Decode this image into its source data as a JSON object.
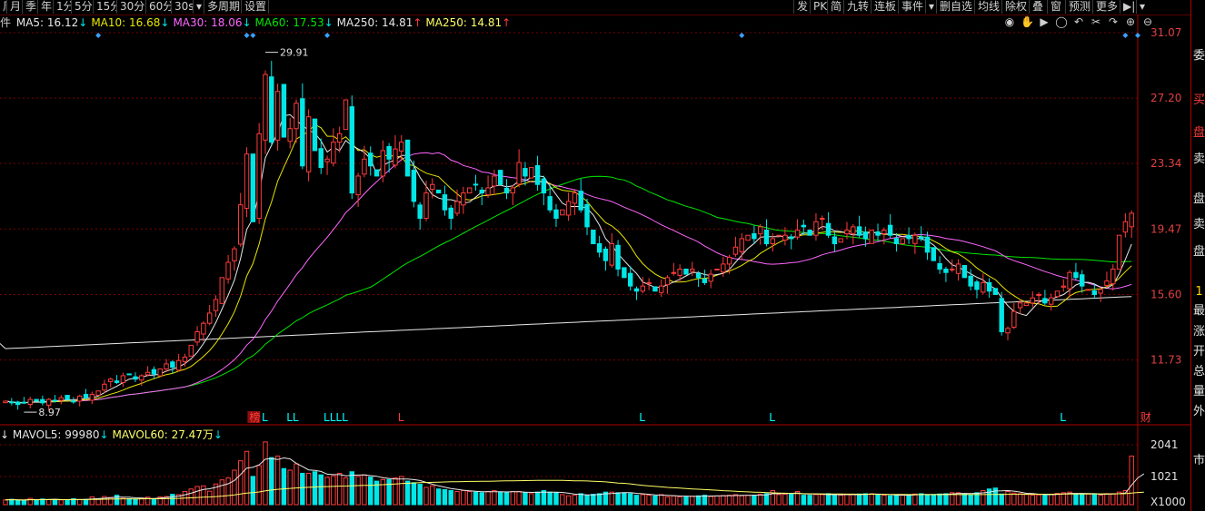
{
  "toolbar": {
    "left": [
      "周",
      "月",
      "季",
      "年",
      "1分",
      "5分",
      "15分",
      "30分",
      "60分",
      "30s",
      "▾",
      "多周期",
      "设置"
    ],
    "right": [
      "发",
      "PK",
      "简",
      "九转",
      "连板",
      "事件",
      "▾",
      "删自选",
      "均线",
      "除权",
      "叠",
      "窗",
      "预测",
      "更多",
      "▶|",
      "▾"
    ],
    "cut_label": "件"
  },
  "ma_legend": [
    {
      "label": "MA5: 16.12",
      "arrow": "↓",
      "color": "#e8e8e8"
    },
    {
      "label": "MA10: 16.68",
      "arrow": "↓",
      "color": "#e6e600"
    },
    {
      "label": "MA30: 18.06",
      "arrow": "↓",
      "color": "#ff66ff"
    },
    {
      "label": "MA60: 17.53",
      "arrow": "↓",
      "color": "#00e600"
    },
    {
      "label": "MA250: 14.81",
      "arrow": "↑",
      "color": "#e8e8e8"
    },
    {
      "label": "MA250: 14.81",
      "arrow": "↑",
      "color": "#ffff66"
    }
  ],
  "vol_legend": [
    {
      "label": "↓ MAVOL5: 99980",
      "arrow": "↓",
      "color": "#e8e8e8"
    },
    {
      "label": "MAVOL60: 27.47万",
      "arrow": "↓",
      "color": "#ffff66"
    }
  ],
  "toolbar_icons": [
    "eye-icon",
    "hand-icon",
    "play-icon",
    "circle-icon",
    "undo-icon",
    "scissors-icon",
    "redo-icon",
    "zoom-in-icon",
    "zoom-out-icon"
  ],
  "chart_data": {
    "type": "candlestick",
    "price_axis": {
      "ticks": [
        "31.07",
        "27.20",
        "23.34",
        "19.47",
        "15.60",
        "11.73"
      ],
      "min": 8.6,
      "max": 31.07
    },
    "volume_axis": {
      "ticks": [
        "2041",
        "1021"
      ],
      "unit": "X1000"
    },
    "annotations": {
      "high": "29.91",
      "low": "8.97"
    },
    "event_markers": [
      {
        "text": "榜",
        "color": "#ff3b3b",
        "boxed": true,
        "index": 40
      },
      {
        "text": "L",
        "color": "#00ffff",
        "index": 42
      },
      {
        "text": "LL",
        "color": "#00ffff",
        "index": 46
      },
      {
        "text": "LLLL",
        "color": "#00ffff",
        "index": 52
      },
      {
        "text": "L",
        "color": "#ff3b3b",
        "index": 64
      },
      {
        "text": "L",
        "color": "#00ffff",
        "index": 103
      },
      {
        "text": "L",
        "color": "#00ffff",
        "index": 124
      },
      {
        "text": "L",
        "color": "#00ffff",
        "index": 171
      },
      {
        "text": "财",
        "color": "#ff3b3b",
        "index": 184
      }
    ],
    "diamonds": [
      15,
      39,
      40,
      52,
      119,
      181,
      183
    ],
    "closes": [
      9.3,
      9.2,
      9.1,
      9.2,
      9.4,
      9.3,
      9.2,
      9.4,
      9.3,
      9.5,
      9.4,
      9.3,
      9.6,
      9.5,
      9.7,
      9.9,
      10.3,
      10.6,
      10.4,
      10.8,
      10.9,
      10.6,
      10.8,
      11.0,
      10.9,
      11.2,
      11.5,
      11.3,
      11.7,
      11.9,
      12.6,
      13.4,
      13.9,
      14.5,
      15.3,
      16.6,
      17.5,
      18.3,
      20.9,
      23.9,
      19.9,
      25.1,
      28.6,
      24.6,
      27.6,
      24.9,
      25.4,
      26.9,
      23.2,
      26.1,
      24.1,
      23.1,
      23.6,
      24.6,
      25.1,
      27.1,
      21.6,
      22.6,
      23.6,
      23.2,
      22.6,
      24.1,
      23.6,
      24.2,
      24.6,
      22.6,
      21.1,
      20.1,
      21.6,
      22.1,
      21.6,
      20.6,
      20.1,
      21.1,
      21.6,
      21.9,
      22.1,
      21.6,
      21.9,
      22.6,
      22.1,
      21.6,
      21.9,
      23.4,
      22.6,
      23.1,
      22.1,
      21.6,
      20.6,
      20.1,
      20.6,
      21.1,
      21.6,
      20.6,
      19.6,
      18.6,
      18.1,
      17.6,
      18.6,
      17.1,
      16.6,
      16.1,
      15.8,
      16.1,
      16.3,
      15.8,
      16.1,
      16.6,
      16.9,
      17.1,
      16.8,
      17.1,
      16.6,
      16.3,
      16.8,
      17.1,
      17.4,
      17.8,
      18.4,
      18.9,
      19.1,
      18.9,
      19.6,
      18.6,
      18.9,
      19.1,
      19.1,
      18.9,
      19.4,
      19.6,
      19.1,
      19.9,
      20.1,
      19.1,
      18.6,
      18.9,
      19.4,
      19.6,
      19.1,
      18.9,
      19.4,
      19.1,
      19.4,
      19.1,
      18.6,
      18.9,
      18.9,
      19.1,
      18.9,
      18.1,
      17.6,
      17.1,
      16.9,
      17.1,
      17.4,
      16.6,
      16.1,
      15.9,
      16.3,
      15.8,
      15.6,
      13.4,
      13.6,
      14.6,
      15.1,
      15.1,
      15.4,
      15.6,
      15.1,
      15.4,
      15.8,
      16.1,
      16.9,
      16.6,
      16.1,
      15.9,
      15.6,
      15.9,
      16.4,
      17.1,
      19.1,
      19.9,
      20.4
    ],
    "volumes": [
      150,
      170,
      140,
      130,
      200,
      150,
      180,
      160,
      170,
      150,
      140,
      190,
      160,
      170,
      250,
      190,
      260,
      230,
      300,
      200,
      190,
      160,
      210,
      240,
      180,
      250,
      260,
      330,
      320,
      420,
      500,
      580,
      600,
      430,
      660,
      790,
      850,
      1100,
      1400,
      1700,
      900,
      1250,
      2000,
      1500,
      1550,
      1150,
      1100,
      1300,
      1000,
      1000,
      1050,
      950,
      870,
      920,
      1000,
      850,
      1050,
      900,
      950,
      880,
      750,
      800,
      800,
      850,
      900,
      750,
      700,
      650,
      550,
      600,
      500,
      480,
      450,
      420,
      450,
      420,
      400,
      380,
      420,
      450,
      400,
      380,
      420,
      420,
      380,
      350,
      400,
      450,
      400,
      380,
      320,
      280,
      300,
      350,
      300,
      330,
      350,
      400,
      400,
      380,
      380,
      350,
      300,
      320,
      300,
      280,
      320,
      250,
      280,
      250,
      260,
      270,
      280,
      300,
      260,
      280,
      290,
      300,
      320,
      280,
      300,
      300,
      330,
      350,
      450,
      320,
      330,
      350,
      420,
      300,
      300,
      320,
      320,
      350,
      300,
      300,
      320,
      330,
      340,
      350,
      350,
      310,
      300,
      280,
      300,
      310,
      320,
      340,
      350,
      300,
      320,
      340,
      350,
      380,
      380,
      350,
      320,
      380,
      450,
      500,
      530,
      340,
      420,
      370,
      350,
      330,
      300,
      310,
      320,
      330,
      360,
      380,
      400,
      330,
      330,
      340,
      350,
      300,
      350,
      350,
      400,
      450,
      1550,
      1500,
      1000
    ]
  },
  "right_panel": [
    "委",
    "买",
    "盘",
    "卖",
    "盘",
    "卖",
    "盘",
    "1",
    "最",
    "涨",
    "开",
    "总",
    "量",
    "外",
    "市"
  ]
}
